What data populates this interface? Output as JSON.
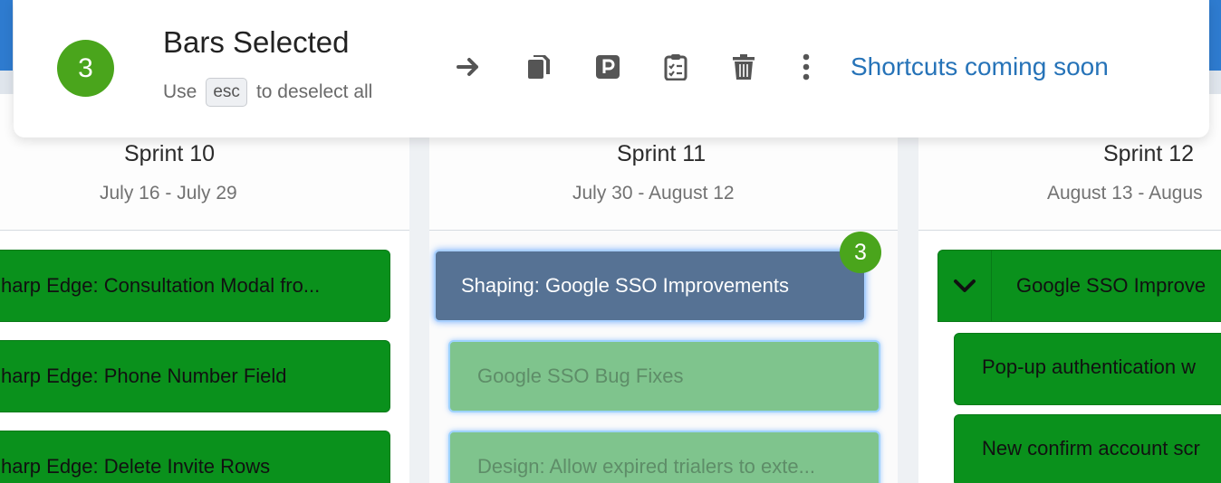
{
  "selection": {
    "count": "3",
    "title": "Bars Selected",
    "hint_prefix": "Use",
    "hint_key": "esc",
    "hint_suffix": "to deselect all",
    "shortcuts_text": "Shortcuts coming soon",
    "actions": [
      "arrow-right-icon",
      "copy-icon",
      "parking-icon",
      "clipboard-checklist-icon",
      "trash-icon",
      "more-vertical-icon"
    ]
  },
  "sprints": [
    {
      "title": "Sprint 10",
      "dates": "July 16 - July 29"
    },
    {
      "title": "Sprint 11",
      "dates": "July 30 - August 12"
    },
    {
      "title": "Sprint 12",
      "dates": "August 13 - Augus"
    }
  ],
  "bars": {
    "sprint10": [
      "harp Edge: Consultation Modal fro...",
      "harp Edge: Phone Number Field",
      "harp Edge: Delete Invite Rows"
    ],
    "sprint11_parent": "Shaping: Google SSO Improvements",
    "sprint11_parent_badge": "3",
    "sprint11_children": [
      "Google SSO Bug Fixes",
      "Design: Allow expired trialers to exte..."
    ],
    "sprint12_parent": "Google SSO Improve",
    "sprint12_children": [
      "Pop-up authentication w",
      "New confirm account scr"
    ]
  },
  "colors": {
    "bar_green": "#0a911c",
    "bar_selected": "#567294",
    "badge_green": "#4aa51c",
    "link_blue": "#2673b8"
  }
}
